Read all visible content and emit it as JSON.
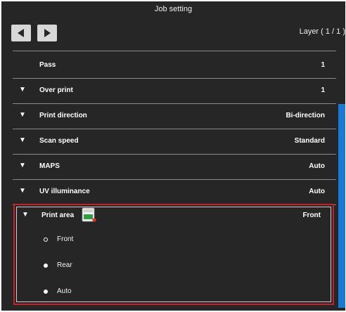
{
  "window": {
    "title": "Job setting"
  },
  "nav": {
    "prev_icon": "left-arrow-icon",
    "next_icon": "right-arrow-icon",
    "layer_text": "Layer ( 1 / 1 )"
  },
  "settings": [
    {
      "label": "Pass",
      "value": "1",
      "expandable": false
    },
    {
      "label": "Over print",
      "value": "1",
      "expandable": true
    },
    {
      "label": "Print direction",
      "value": "Bi-direction",
      "expandable": true
    },
    {
      "label": "Scan speed",
      "value": "Standard",
      "expandable": true
    },
    {
      "label": "MAPS",
      "value": "Auto",
      "expandable": true
    },
    {
      "label": "UV illuminance",
      "value": "Auto",
      "expandable": true
    }
  ],
  "print_area": {
    "label": "Print area",
    "value": "Front",
    "icon": "print-area-icon",
    "options": [
      {
        "label": "Front",
        "selected": true
      },
      {
        "label": "Rear",
        "selected": false
      },
      {
        "label": "Auto",
        "selected": false
      }
    ],
    "highlight_color": "#c6202a"
  },
  "colors": {
    "background": "#262626",
    "scrollbar": "#1a78d6",
    "button": "#d8d8d8"
  }
}
